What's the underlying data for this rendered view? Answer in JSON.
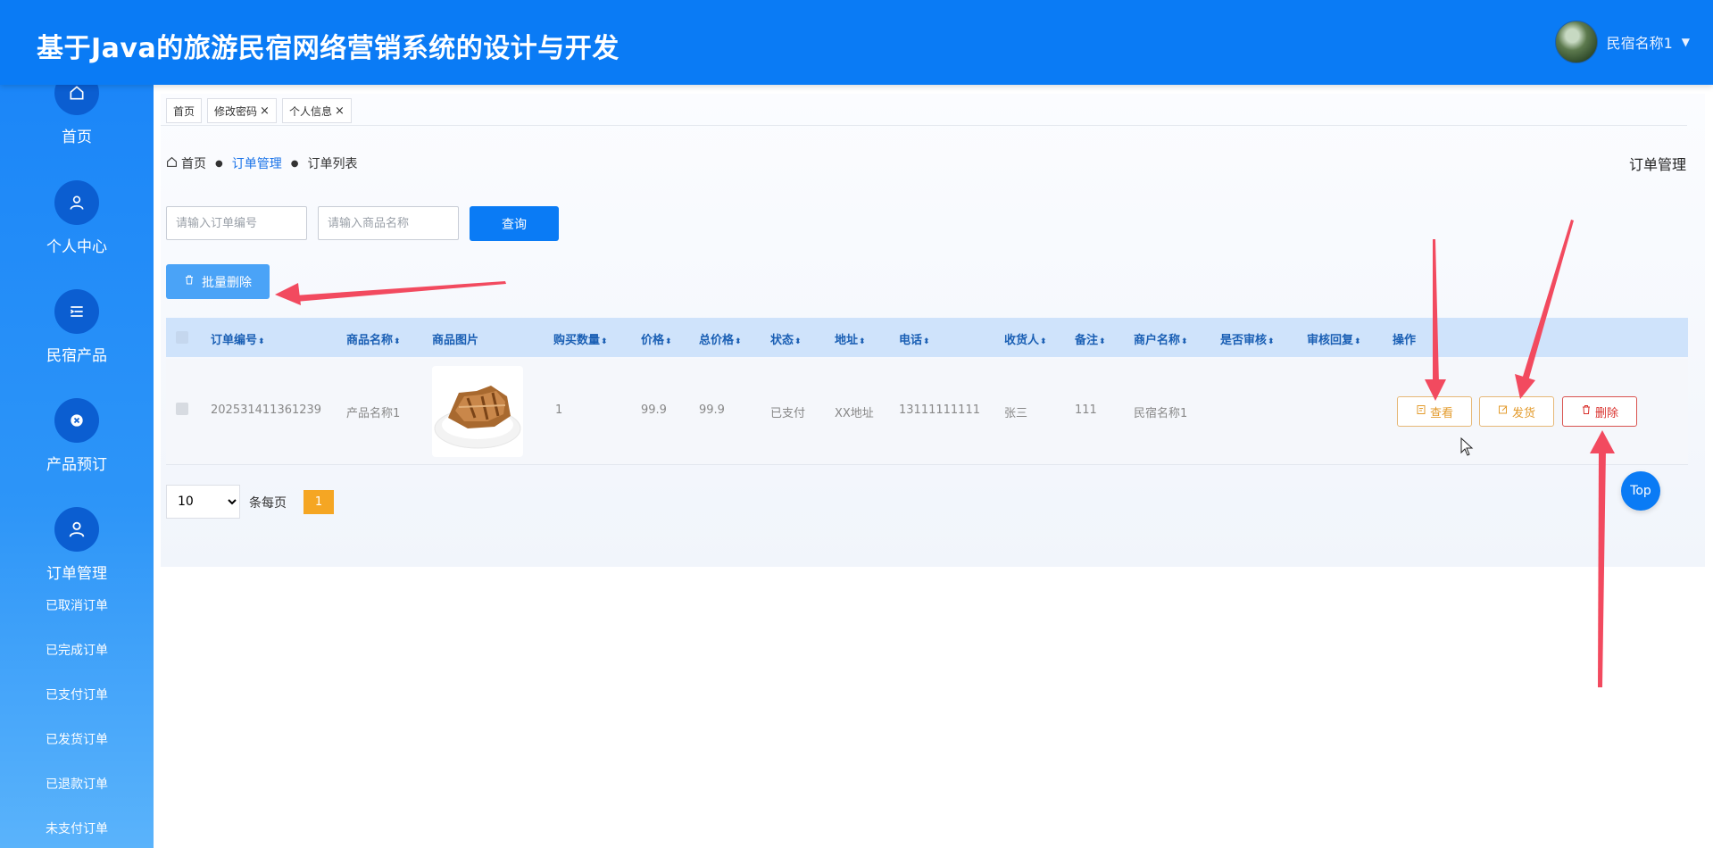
{
  "header": {
    "title": "基于Java的旅游民宿网络营销系统的设计与开发",
    "user_name": "民宿名称1"
  },
  "sidebar": {
    "items": [
      {
        "label": "首页",
        "icon": "home-icon"
      },
      {
        "label": "个人中心",
        "icon": "user-icon"
      },
      {
        "label": "民宿产品",
        "icon": "list-icon"
      },
      {
        "label": "产品预订",
        "icon": "close-circle-icon"
      },
      {
        "label": "订单管理",
        "icon": "user-icon"
      }
    ],
    "sub_items": [
      "已取消订单",
      "已完成订单",
      "已支付订单",
      "已发货订单",
      "已退款订单",
      "未支付订单"
    ]
  },
  "tabs": [
    {
      "label": "首页",
      "closable": false
    },
    {
      "label": "修改密码",
      "closable": true
    },
    {
      "label": "个人信息",
      "closable": true
    }
  ],
  "tab_close_glyph": "×",
  "breadcrumb": {
    "home": "首页",
    "section": "订单管理",
    "current": "订单列表"
  },
  "page_title": "订单管理",
  "search": {
    "order_no_placeholder": "请输入订单编号",
    "product_name_placeholder": "请输入商品名称",
    "query_label": "查询"
  },
  "batch_delete_label": "批量删除",
  "table": {
    "columns": [
      "订单编号",
      "商品名称",
      "商品图片",
      "购买数量",
      "价格",
      "总价格",
      "状态",
      "地址",
      "电话",
      "收货人",
      "备注",
      "商户名称",
      "是否审核",
      "审核回复",
      "操作"
    ],
    "sort_glyph": "⬍",
    "rows": [
      {
        "order_no": "202531411361239",
        "product_name": "产品名称1",
        "quantity": "1",
        "price": "99.9",
        "total_price": "99.9",
        "status": "已支付",
        "address": "XX地址",
        "phone": "13111111111",
        "receiver": "张三",
        "remark": "111",
        "merchant": "民宿名称1",
        "audited": "",
        "audit_reply": ""
      }
    ],
    "actions": {
      "view": "查看",
      "ship": "发货",
      "delete": "删除"
    }
  },
  "pagination": {
    "page_size": "10",
    "per_page_label": "条每页",
    "current_page": "1"
  },
  "top_button": "Top",
  "colors": {
    "primary": "#0a7bf5",
    "warning": "#e39b2c",
    "danger": "#d9302c",
    "annotation": "#f24a5f"
  }
}
